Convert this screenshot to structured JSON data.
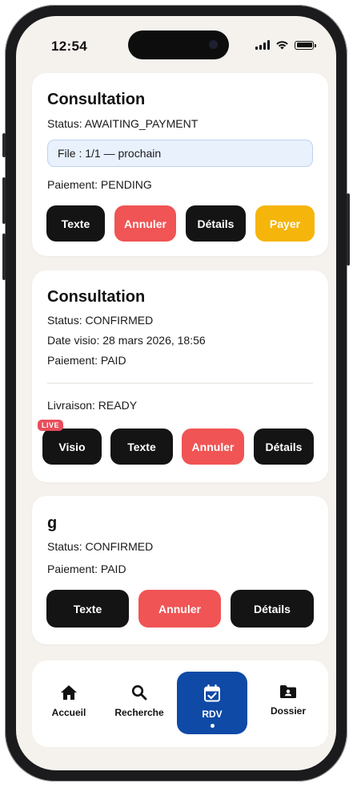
{
  "status_bar": {
    "time": "12:54"
  },
  "cards": [
    {
      "title": "Consultation",
      "status": "Status: AWAITING_PAYMENT",
      "queue": "File : 1/1 — prochain",
      "payment": "Paiement: PENDING",
      "buttons": [
        "Texte",
        "Annuler",
        "Détails",
        "Payer"
      ]
    },
    {
      "title": "Consultation",
      "status": "Status: CONFIRMED",
      "visio_date": "Date visio: 28 mars 2026, 18:56",
      "payment": "Paiement: PAID",
      "delivery": "Livraison: READY",
      "live_badge": "LIVE",
      "buttons": [
        "Visio",
        "Texte",
        "Annuler",
        "Détails"
      ]
    },
    {
      "title": "g",
      "status": "Status: CONFIRMED",
      "payment": "Paiement: PAID",
      "buttons": [
        "Texte",
        "Annuler",
        "Détails"
      ]
    }
  ],
  "nav": {
    "items": [
      {
        "label": "Accueil",
        "icon": "home-icon"
      },
      {
        "label": "Recherche",
        "icon": "search-icon"
      },
      {
        "label": "RDV",
        "icon": "calendar-check-icon",
        "active": true
      },
      {
        "label": "Dossier",
        "icon": "folder-user-icon"
      }
    ]
  },
  "colors": {
    "background": "#f5f2ed",
    "dark_button": "#141414",
    "cancel_button": "#f05454",
    "pay_button": "#f5b50a",
    "nav_active": "#0e4aa6",
    "live_badge": "#e84d5b",
    "queue_bg": "#e9f1fd"
  }
}
